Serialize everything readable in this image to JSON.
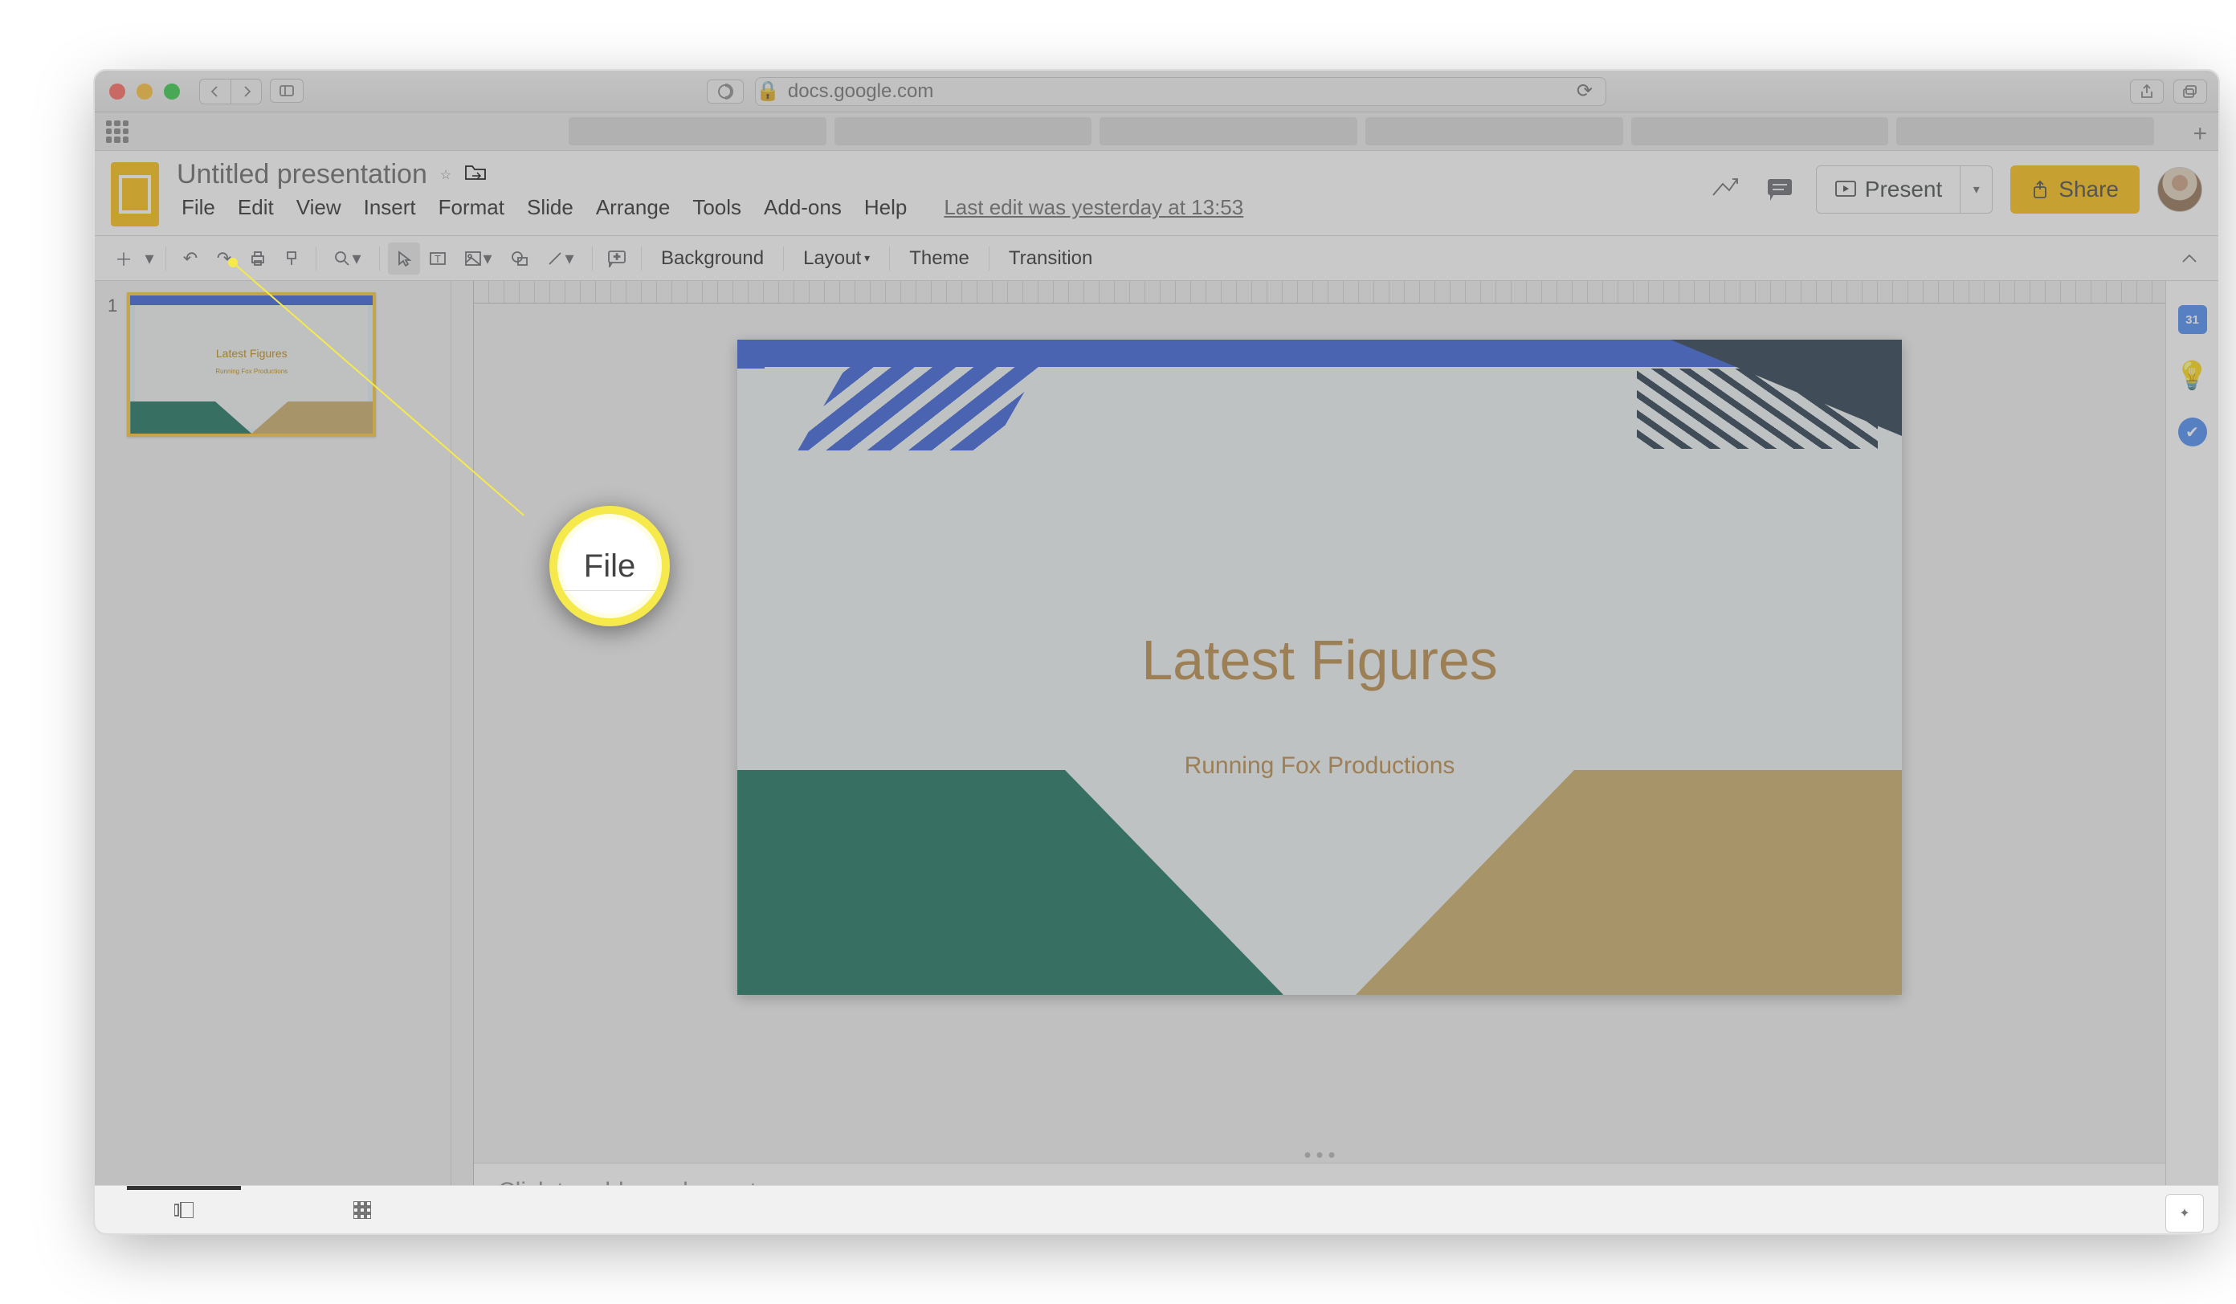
{
  "browser": {
    "url_host": "docs.google.com"
  },
  "docs": {
    "title": "Untitled presentation",
    "last_edit": "Last edit was yesterday at 13:53",
    "menus": {
      "file": "File",
      "edit": "Edit",
      "view": "View",
      "insert": "Insert",
      "format": "Format",
      "slide": "Slide",
      "arrange": "Arrange",
      "tools": "Tools",
      "addons": "Add-ons",
      "help": "Help"
    },
    "present": "Present",
    "share": "Share",
    "toolbar": {
      "background": "Background",
      "layout": "Layout",
      "theme": "Theme",
      "transition": "Transition"
    }
  },
  "slide": {
    "number": "1",
    "title": "Latest Figures",
    "subtitle": "Running Fox Productions"
  },
  "notes_placeholder": "Click to add speaker notes",
  "sidebar_calendar_day": "31",
  "callout_label": "File"
}
